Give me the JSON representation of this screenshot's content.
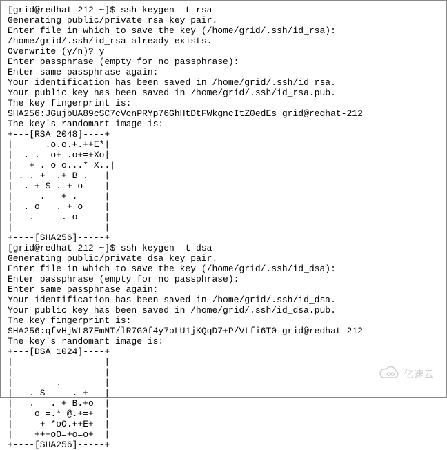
{
  "lines": {
    "l0": "[grid@redhat-212 ~]$ ssh-keygen -t rsa",
    "l1": "Generating public/private rsa key pair.",
    "l2": "Enter file in which to save the key (/home/grid/.ssh/id_rsa):",
    "l3": "/home/grid/.ssh/id_rsa already exists.",
    "l4": "Overwrite (y/n)? y",
    "l5": "Enter passphrase (empty for no passphrase):",
    "l6": "Enter same passphrase again:",
    "l7": "Your identification has been saved in /home/grid/.ssh/id_rsa.",
    "l8": "Your public key has been saved in /home/grid/.ssh/id_rsa.pub.",
    "l9": "The key fingerprint is:",
    "l10": "SHA256:JGujbUA89cSC7cVcnPRYp76GhHtDtFWkgncItZ0edEs grid@redhat-212",
    "l11": "The key's randomart image is:",
    "l12": "+---[RSA 2048]----+",
    "l13": "|      .o.o.+.++E*|",
    "l14": "|  . .  o+ .o+=+Xo|",
    "l15": "|   + . o o...* X..|",
    "l16": "| . . +  .+ B .   |",
    "l17": "|  . + S . + o    |",
    "l18": "|   = .   + .     |",
    "l19": "|  . o   . + o    |",
    "l20": "|   .     . o     |",
    "l21": "|                 |",
    "l22": "+----[SHA256]-----+",
    "l23": "[grid@redhat-212 ~]$ ssh-keygen -t dsa",
    "l24": "Generating public/private dsa key pair.",
    "l25": "Enter file in which to save the key (/home/grid/.ssh/id_dsa):",
    "l26": "Enter passphrase (empty for no passphrase):",
    "l27": "Enter same passphrase again:",
    "l28": "Your identification has been saved in /home/grid/.ssh/id_dsa.",
    "l29": "Your public key has been saved in /home/grid/.ssh/id_dsa.pub.",
    "l30": "The key fingerprint is:",
    "l31": "SHA256:qfvHjWt87EmNT/lR7G0f4y7oLU1jKQqD7+P/Vtfi6T0 grid@redhat-212",
    "l32": "The key's randomart image is:",
    "l33": "+---[DSA 1024]----+",
    "l34": "|                 |",
    "l35": "|                 |",
    "l36": "|        .        |",
    "l37": "|   . S     . +   |",
    "l38": "|   . = . + B.+o  |",
    "l39": "|    o =.* @.+=+  |",
    "l40": "|     + *oO.++E+  |",
    "l41": "|    +++oO=+o=o+  |",
    "l42": "+----[SHA256]-----+"
  },
  "watermark": {
    "text": "亿速云"
  }
}
